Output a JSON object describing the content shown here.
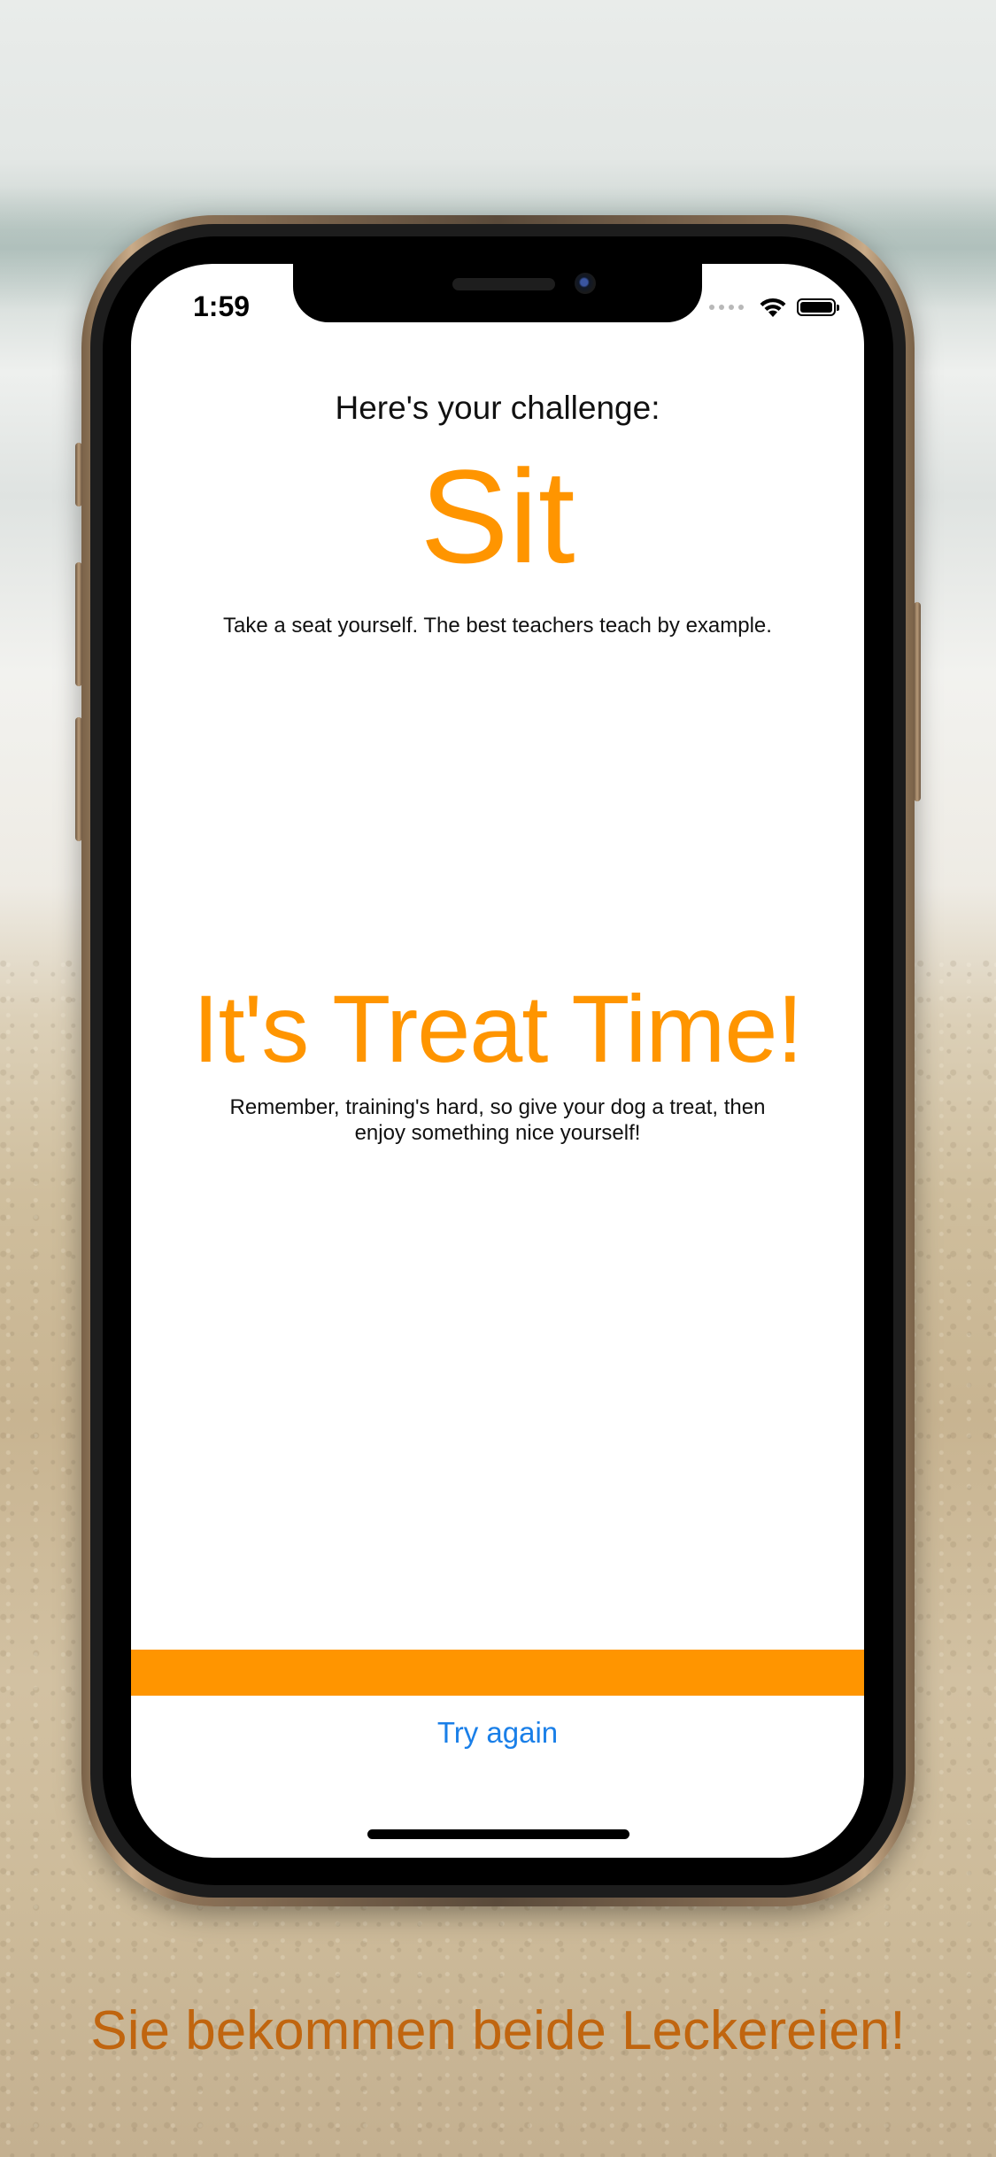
{
  "status_bar": {
    "time": "1:59",
    "wifi_icon": "wifi-icon",
    "battery_icon": "battery-icon"
  },
  "challenge": {
    "label": "Here's your challenge:",
    "command": "Sit",
    "description": "Take a seat yourself. The best teachers teach by example."
  },
  "treat": {
    "title": "It's Treat Time!",
    "description": "Remember, training's hard, so give your dog a treat, then enjoy something nice yourself!"
  },
  "actions": {
    "try_again_label": "Try again"
  },
  "caption": "Sie bekommen beide Leckereien!",
  "colors": {
    "accent": "#FF9500",
    "link": "#1A7FE8",
    "caption": "#C0650F"
  }
}
